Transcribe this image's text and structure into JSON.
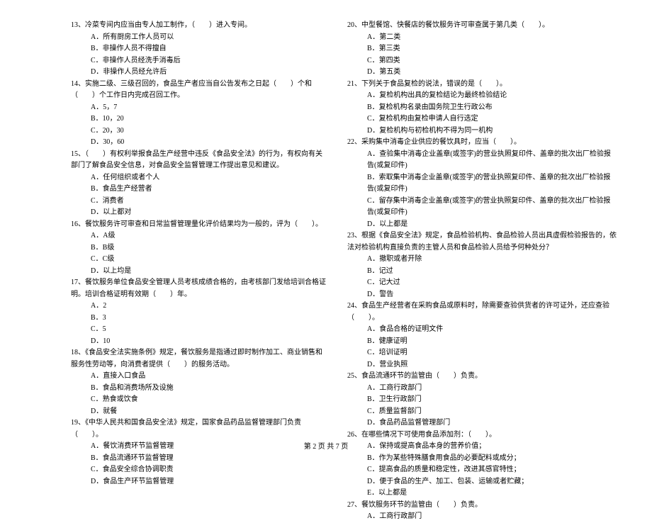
{
  "footer": "第 2 页  共 7 页",
  "left": [
    {
      "stem": "13、冷菜专间内应当由专人加工制作，（　　）进入专间。",
      "opts": [
        "A．所有厨房工作人员可以",
        "B．非操作人员不得擅自",
        "C．非操作人员经洗手消毒后",
        "D．非操作人员经允许后"
      ]
    },
    {
      "stem": "14、实施二级、三级召回的，食品生产者应当自公告发布之日起（　　）个和（　　）个工作日内完成召回工作。",
      "opts": [
        "A．5，7",
        "B．10，20",
        "C．20，30",
        "D．30，60"
      ]
    },
    {
      "stem": "15、（　　）有权利举报食品生产经营中违反《食品安全法》的行为，有权向有关部门了解食品安全信息，对食品安全监督管理工作提出意见和建议。",
      "opts": [
        "A．任何组织或者个人",
        "B．食品生产经营者",
        "C．消费者",
        "D．以上都对"
      ]
    },
    {
      "stem": "16、餐饮服务许可审查和日常监督管理量化评价结果均为一般的，评为（　　）。",
      "opts": [
        "A．A级",
        "B．B级",
        "C．C级",
        "D．以上均是"
      ]
    },
    {
      "stem": "17、餐饮服务单位食品安全管理人员考核成绩合格的，由考核部门发给培训合格证明。培训合格证明有效期（　　）年。",
      "opts": [
        "A．2",
        "B．3",
        "C．5",
        "D．10"
      ]
    },
    {
      "stem": "18、《食品安全法实施条例》规定，餐饮服务是指通过即时制作加工、商业销售和服务性劳动等，向消费者提供（　　）的服务活动。",
      "opts": [
        "A．直接入口食品",
        "B．食品和消费场所及设施",
        "C．熟食或饮食",
        "D．就餐"
      ]
    },
    {
      "stem": "19、《中华人民共和国食品安全法》规定，国家食品药品监督管理部门负责（　　）。",
      "opts": [
        "A．餐饮消费环节监督管理",
        "B．食品流通环节监督管理",
        "C．食品安全综合协调职责",
        "D．食品生产环节监督管理"
      ]
    }
  ],
  "right": [
    {
      "stem": "20、中型餐馆、快餐店的餐饮服务许可审查属于第几类（　　）。",
      "opts": [
        "A．第二类",
        "B．第三类",
        "C．第四类",
        "D．第五类"
      ]
    },
    {
      "stem": "21、下列关于食品复检的说法，错误的是（　　）。",
      "opts": [
        "A．复检机构出具的复检结论为最终检验结论",
        "B．复检机构名录由国务院卫生行政公布",
        "C．复检机构由复检申请人自行选定",
        "D．复检机构与初检机构不得为同一机构"
      ]
    },
    {
      "stem": "22、采购集中消毒企业供应的餐饮具时，应当（　　）。",
      "opts": [
        "A．查验集中消毒企业盖章(或签字)的营业执照复印件、盖章的批次出厂检验报告(或复印件)",
        "B．索取集中消毒企业盖章(或签字)的营业执照复印件、盖章的批次出厂检验报告(或复印件)",
        "C．留存集中消毒企业盖章(或签字)的营业执照复印件、盖章的批次出厂检验报告(或复印件)",
        "D．以上都是"
      ]
    },
    {
      "stem": "23、根据《食品安全法》规定，食品检验机构、食品检验人员出具虚假检验报告的，依法对检验机构直接负责的主管人员和食品检验人员给予何种处分？",
      "opts": [
        "A．撤职或者开除",
        "B．记过",
        "C．记大过",
        "D．警告"
      ]
    },
    {
      "stem": "24、食品生产经营者在采购食品或原料时，除需要查验供货者的许可证外，还应查验（　　）。",
      "opts": [
        "A．食品合格的证明文件",
        "B．健康证明",
        "C．培训证明",
        "D．营业执照"
      ]
    },
    {
      "stem": "25、食品流通环节的监管由（　　）负责。",
      "opts": [
        "A．工商行政部门",
        "B．卫生行政部门",
        "C．质量监督部门",
        "D．食品药品监督管理部门"
      ]
    },
    {
      "stem": "26、在哪些情况下可使用食品添加剂：（　　）。",
      "opts": [
        "A．保持或提高食品本身的营养价值；",
        "B．作为某些特殊膳食用食品的必要配料或成分；",
        "C．提高食品的质量和稳定性，改进其感官特性；",
        "D．便于食品的生产、加工、包装、运输或者贮藏；",
        "E．以上都是"
      ]
    },
    {
      "stem": "27、餐饮服务环节的监管由（　　）负责。",
      "opts": [
        "A．工商行政部门"
      ]
    }
  ]
}
